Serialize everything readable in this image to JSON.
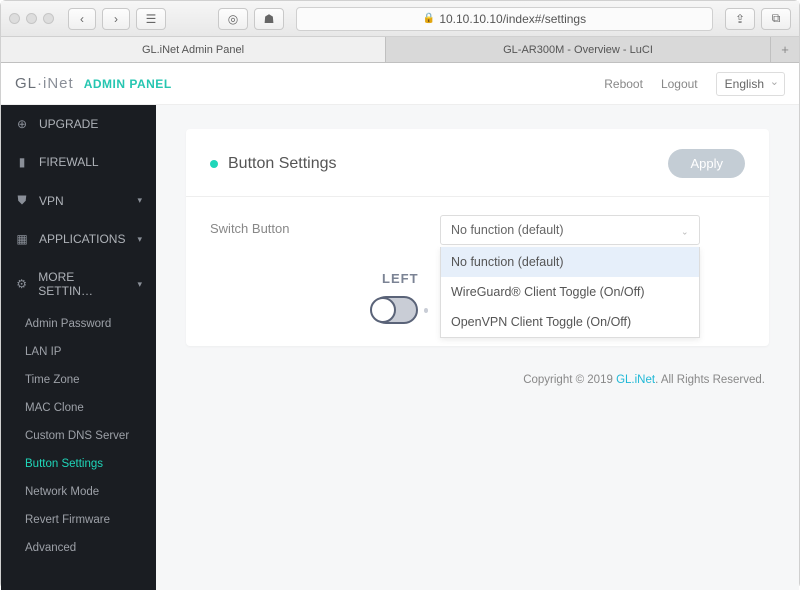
{
  "browser": {
    "url": "10.10.10.10/index#/settings",
    "tabs": [
      {
        "label": "GL.iNet Admin Panel",
        "active": true
      },
      {
        "label": "GL-AR300M - Overview - LuCI",
        "active": false
      }
    ]
  },
  "header": {
    "logo_prefix": "GL",
    "logo_middle": "·",
    "logo_suffix": "iNet",
    "admin_label": "ADMIN PANEL",
    "reboot": "Reboot",
    "logout": "Logout",
    "language": "English"
  },
  "nav": {
    "items": [
      {
        "icon": "⟳",
        "label": "UPGRADE",
        "caret": false
      },
      {
        "icon": "▲",
        "label": "FIREWALL",
        "caret": false
      },
      {
        "icon": "⛨",
        "label": "VPN",
        "caret": true
      },
      {
        "icon": "⋮⋮",
        "label": "APPLICATIONS",
        "caret": true
      },
      {
        "icon": "⚙",
        "label": "MORE SETTIN…",
        "caret": true
      }
    ],
    "subs": [
      "Admin Password",
      "LAN IP",
      "Time Zone",
      "MAC Clone",
      "Custom DNS Server",
      "Button Settings",
      "Network Mode",
      "Revert Firmware",
      "Advanced"
    ],
    "active_sub": "Button Settings"
  },
  "card": {
    "title": "Button Settings",
    "apply": "Apply",
    "field_label": "Switch Button",
    "selected": "No function (default)",
    "options": [
      "No function (default)",
      "WireGuard® Client Toggle (On/Off)",
      "OpenVPN Client Toggle (On/Off)"
    ],
    "left_label": "LEFT"
  },
  "footer": {
    "prefix": "Copyright © 2019 ",
    "link": "GL.iNet",
    "suffix": ". All Rights Reserved."
  }
}
